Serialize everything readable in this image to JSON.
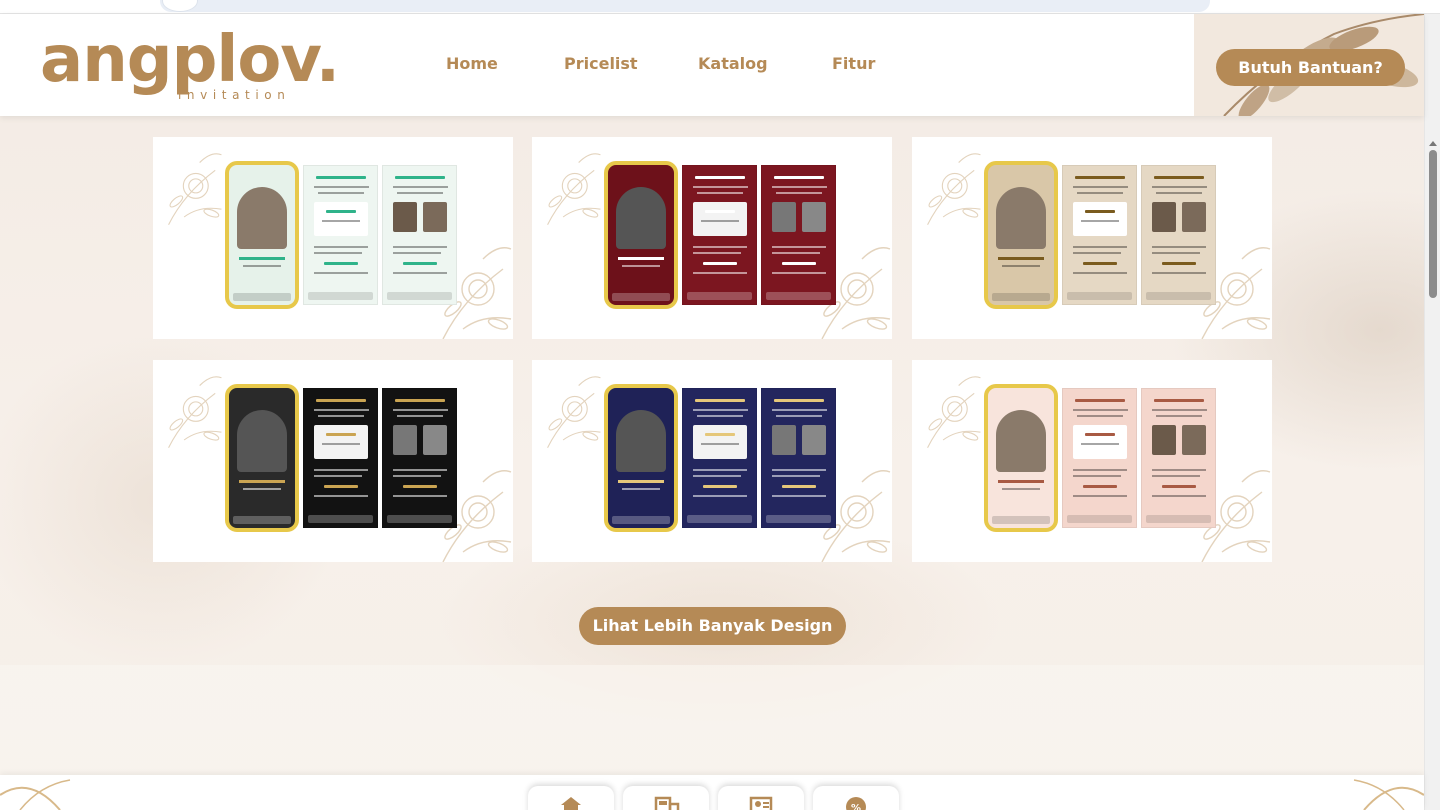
{
  "brand": {
    "logo_text": "angplov",
    "logo_dot": ".",
    "logo_sub": "invitation"
  },
  "nav": [
    {
      "label": "Home"
    },
    {
      "label": "Pricelist"
    },
    {
      "label": "Katalog"
    },
    {
      "label": "Fitur"
    }
  ],
  "help_button": {
    "label": "Butuh Bantuan?"
  },
  "catalog": {
    "more_button": "Lihat Lebih Banyak Design",
    "cards": [
      {
        "theme": "green-watercolor",
        "colors": {
          "bg": "#eef6f1",
          "accent": "#2fb38a",
          "phone_bg": "#e6f2ea"
        }
      },
      {
        "theme": "maroon",
        "colors": {
          "bg": "#7c1620",
          "accent": "#ffffff",
          "phone_bg": "#6d111a"
        }
      },
      {
        "theme": "beige-gold",
        "colors": {
          "bg": "#e5d8c4",
          "accent": "#7a5b1e",
          "phone_bg": "#d9c7a8"
        }
      },
      {
        "theme": "black-gold",
        "colors": {
          "bg": "#121212",
          "accent": "#caa452",
          "phone_bg": "#2a2a2a"
        }
      },
      {
        "theme": "navy",
        "colors": {
          "bg": "#23265e",
          "accent": "#e5c77a",
          "phone_bg": "#1f2257"
        }
      },
      {
        "theme": "blush-pink",
        "colors": {
          "bg": "#f4d6cc",
          "accent": "#a85a43",
          "phone_bg": "#f8e4dc"
        }
      }
    ]
  },
  "bottom_nav": [
    {
      "icon": "home-icon"
    },
    {
      "icon": "catalog-icon"
    },
    {
      "icon": "contact-card-icon"
    },
    {
      "icon": "discount-icon"
    }
  ],
  "colors": {
    "brand": "#b58a56",
    "background": "#f5ede6",
    "phone_frame": "#e7c84a"
  }
}
